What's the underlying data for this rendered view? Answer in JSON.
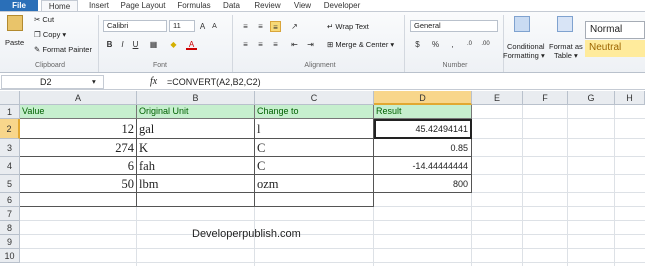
{
  "tabs": [
    "File",
    "Home",
    "Insert",
    "Page Layout",
    "Formulas",
    "Data",
    "Review",
    "View",
    "Developer"
  ],
  "ribbon": {
    "clipboard": {
      "paste": "Paste",
      "cut": "Cut",
      "copy": "Copy",
      "format_painter": "Format Painter",
      "label": "Clipboard"
    },
    "font": {
      "name": "Calibri",
      "size": "11",
      "bold": "B",
      "italic": "I",
      "underline": "U",
      "label": "Font"
    },
    "alignment": {
      "wrap_text": "Wrap Text",
      "merge_center": "Merge & Center",
      "label": "Alignment"
    },
    "number": {
      "format": "General",
      "currency": "$",
      "percent": "%",
      "comma": ",",
      "label": "Number"
    },
    "styles": {
      "conditional": "Conditional",
      "formatting": "Formatting",
      "format_as": "Format as",
      "table": "Table",
      "normal": "Normal",
      "neutral": "Neutral"
    }
  },
  "formula_bar": {
    "cell_ref": "D2",
    "fx": "fx",
    "formula": "=CONVERT(A2,B2,C2)"
  },
  "columns": [
    "A",
    "B",
    "C",
    "D",
    "E",
    "F",
    "G",
    "H"
  ],
  "rows": [
    "1",
    "2",
    "3",
    "4",
    "5",
    "6",
    "7",
    "8",
    "9",
    "10"
  ],
  "table": {
    "headers": [
      "Value",
      "Original Unit",
      "Change to",
      "Result"
    ],
    "data": [
      [
        "12",
        "gal",
        "l",
        "45.42494141"
      ],
      [
        "274",
        "K",
        "C",
        "0.85"
      ],
      [
        "6",
        "fah",
        "C",
        "-14.44444444"
      ],
      [
        "50",
        "lbm",
        "ozm",
        "800"
      ]
    ]
  },
  "watermark": "Developerpublish.com",
  "colors": {
    "header_fill": "#c6efce",
    "header_text": "#006100",
    "selection": "#f8d68b",
    "file_tab": "#2a6fb8"
  }
}
